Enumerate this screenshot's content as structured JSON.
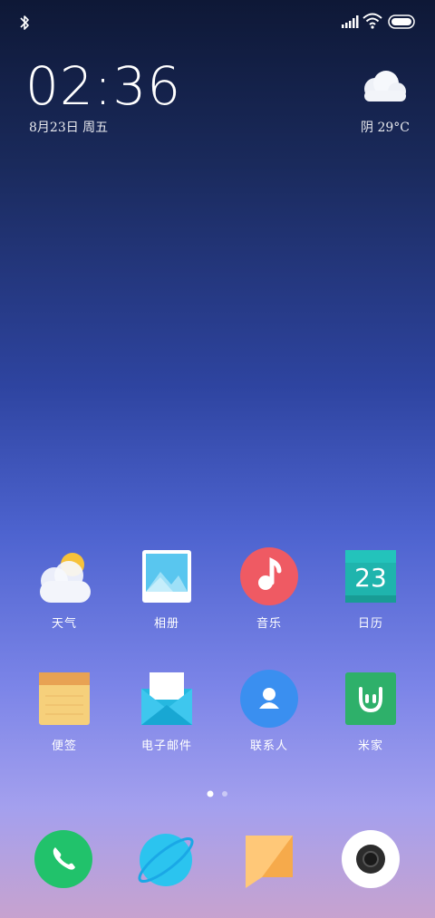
{
  "status": {
    "bluetooth_icon": "bluetooth-icon",
    "signal_icon": "signal-bars-icon",
    "wifi_icon": "wifi-icon",
    "battery_icon": "battery-icon"
  },
  "clock_widget": {
    "time": "02:36",
    "date": "8月23日 周五"
  },
  "weather_widget": {
    "icon": "cloud-icon",
    "summary": "阴 29°C"
  },
  "apps_row1": [
    {
      "label": "天气",
      "icon": "weather-icon"
    },
    {
      "label": "相册",
      "icon": "gallery-icon"
    },
    {
      "label": "音乐",
      "icon": "music-icon"
    },
    {
      "label": "日历",
      "icon": "calendar-icon",
      "badge": "23"
    }
  ],
  "apps_row2": [
    {
      "label": "便签",
      "icon": "notes-icon"
    },
    {
      "label": "电子邮件",
      "icon": "email-icon"
    },
    {
      "label": "联系人",
      "icon": "contacts-icon"
    },
    {
      "label": "米家",
      "icon": "mihome-icon"
    }
  ],
  "page_indicator": {
    "pages": 2,
    "current": 1
  },
  "dock": [
    {
      "icon": "phone-icon"
    },
    {
      "icon": "browser-icon"
    },
    {
      "icon": "messages-icon"
    },
    {
      "icon": "camera-icon"
    }
  ],
  "colors": {
    "music": "#ef5a63",
    "calendar": "#1fb4ad",
    "notes": "#f6d07b",
    "mihome": "#2eb06a",
    "contacts": "#3a8ff0",
    "phone": "#21c26b"
  }
}
